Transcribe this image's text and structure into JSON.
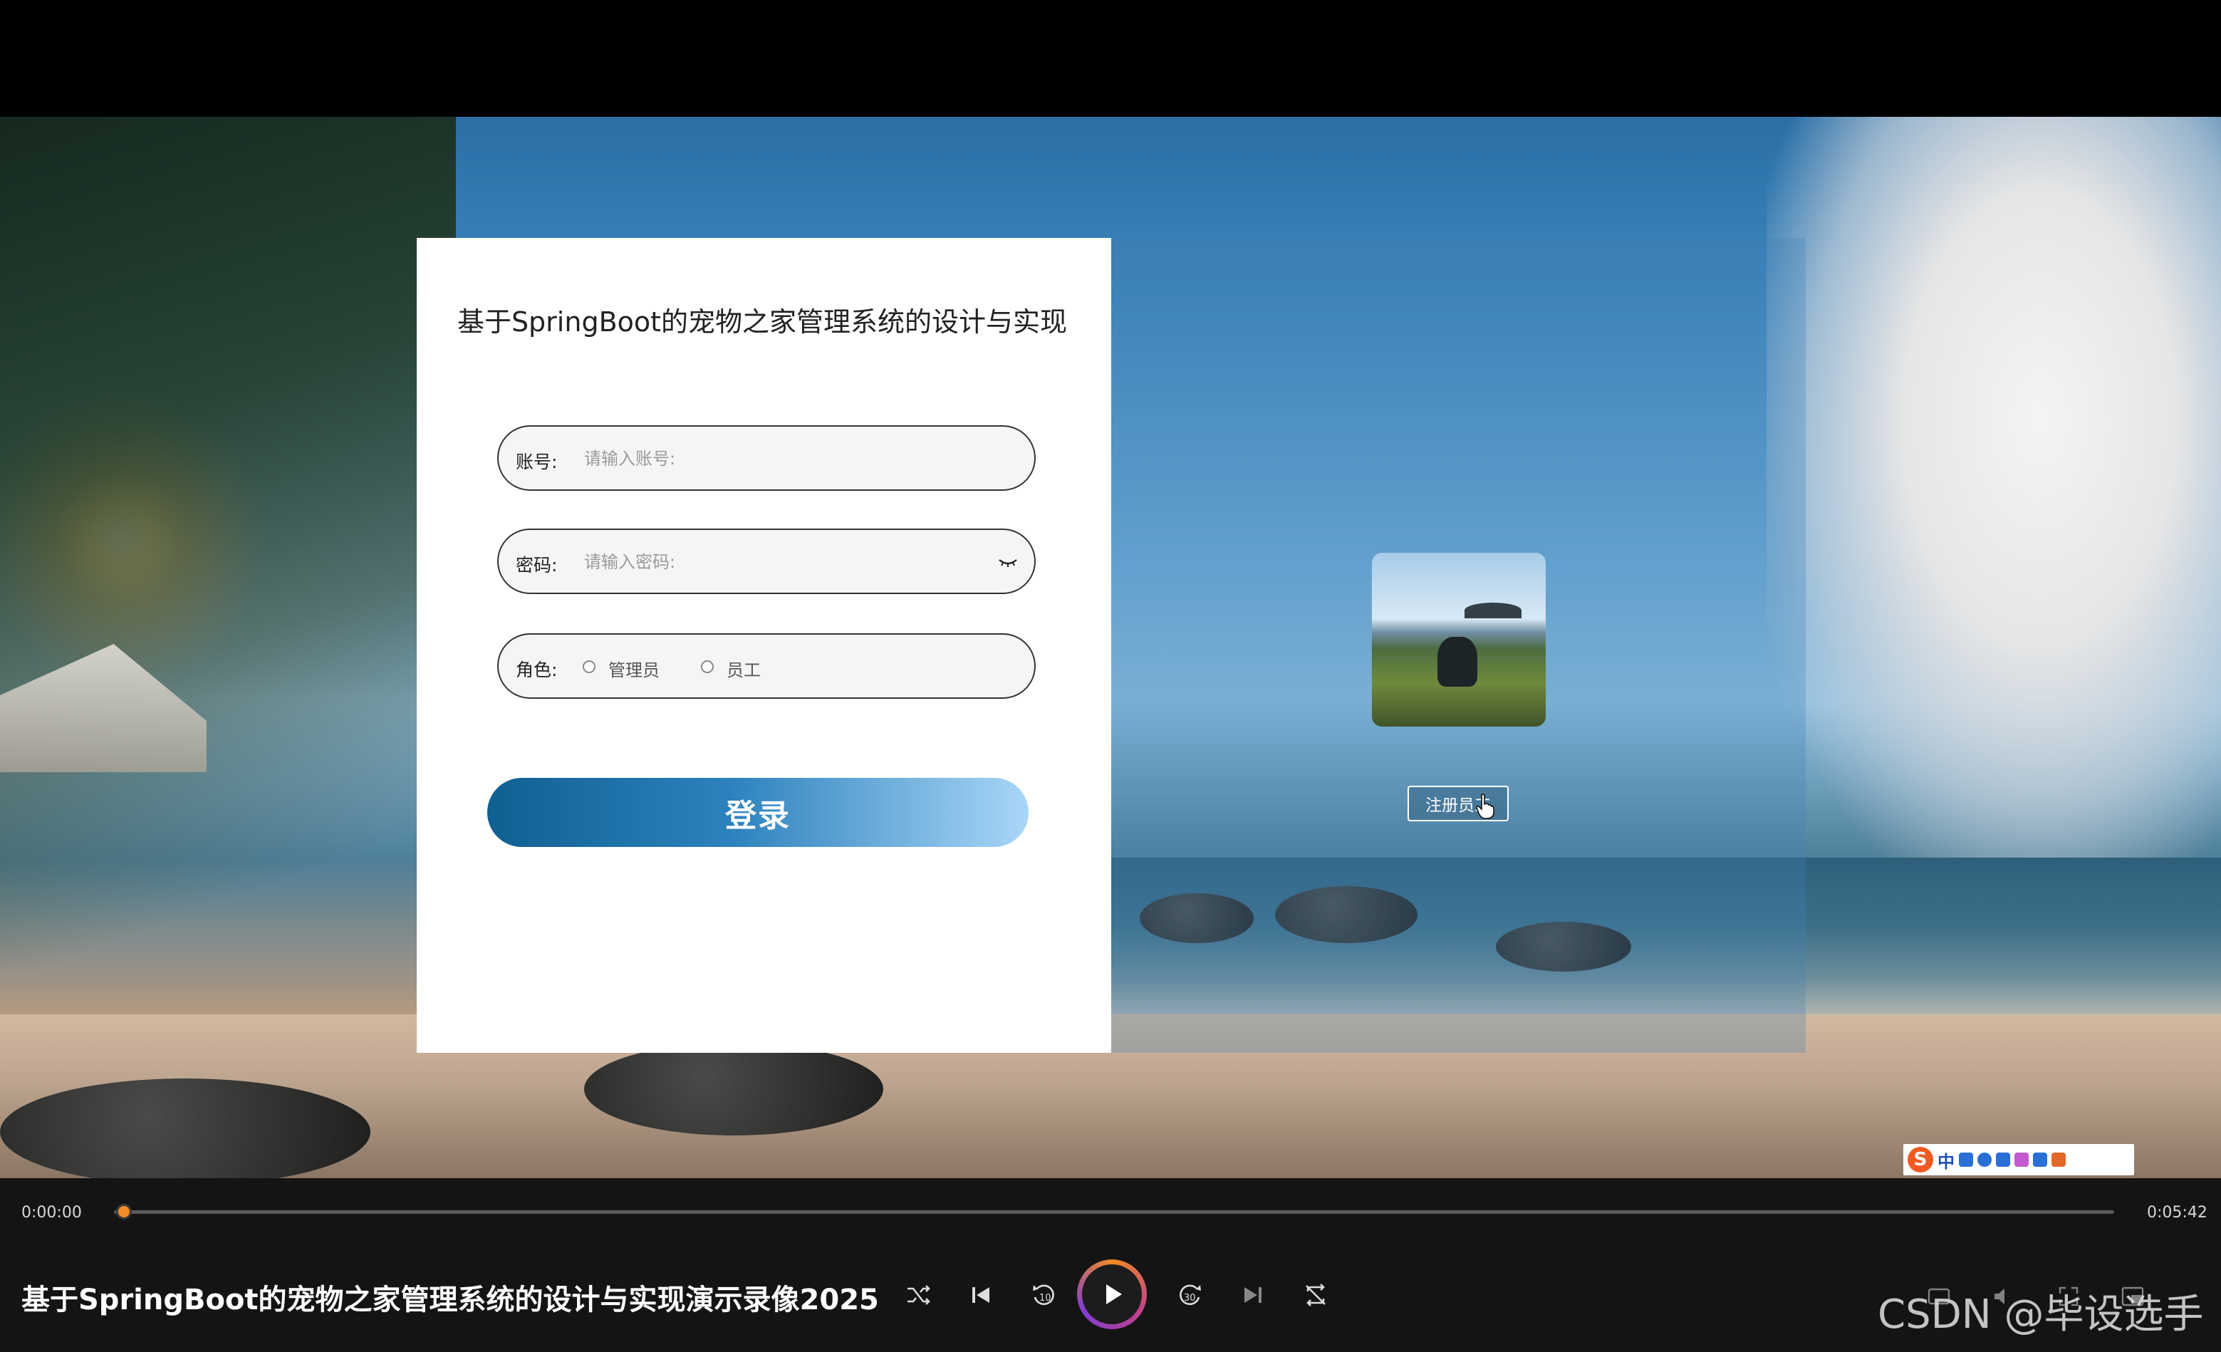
{
  "login": {
    "title": "基于SpringBoot的宠物之家管理系统的设计与实现",
    "account_label": "账号:",
    "account_placeholder": "请输入账号:",
    "password_label": "密码:",
    "password_placeholder": "请输入密码:",
    "role_label": "角色:",
    "roles": [
      "管理员",
      "员工"
    ],
    "login_button": "登录"
  },
  "register": {
    "button_label": "注册员工"
  },
  "ime": {
    "logo": "S",
    "language": "中"
  },
  "player": {
    "time_current": "0:00:00",
    "time_total": "0:05:42",
    "progress": 0.0,
    "title": "基于SpringBoot的宠物之家管理系统的设计与实现演示录像2025",
    "controls": [
      "shuffle-icon",
      "previous-icon",
      "rewind-10-icon",
      "play-icon",
      "forward-30-icon",
      "next-icon",
      "repeat-off-icon"
    ],
    "accent_color": "#f28c28"
  },
  "watermark": "CSDN @毕设选手"
}
